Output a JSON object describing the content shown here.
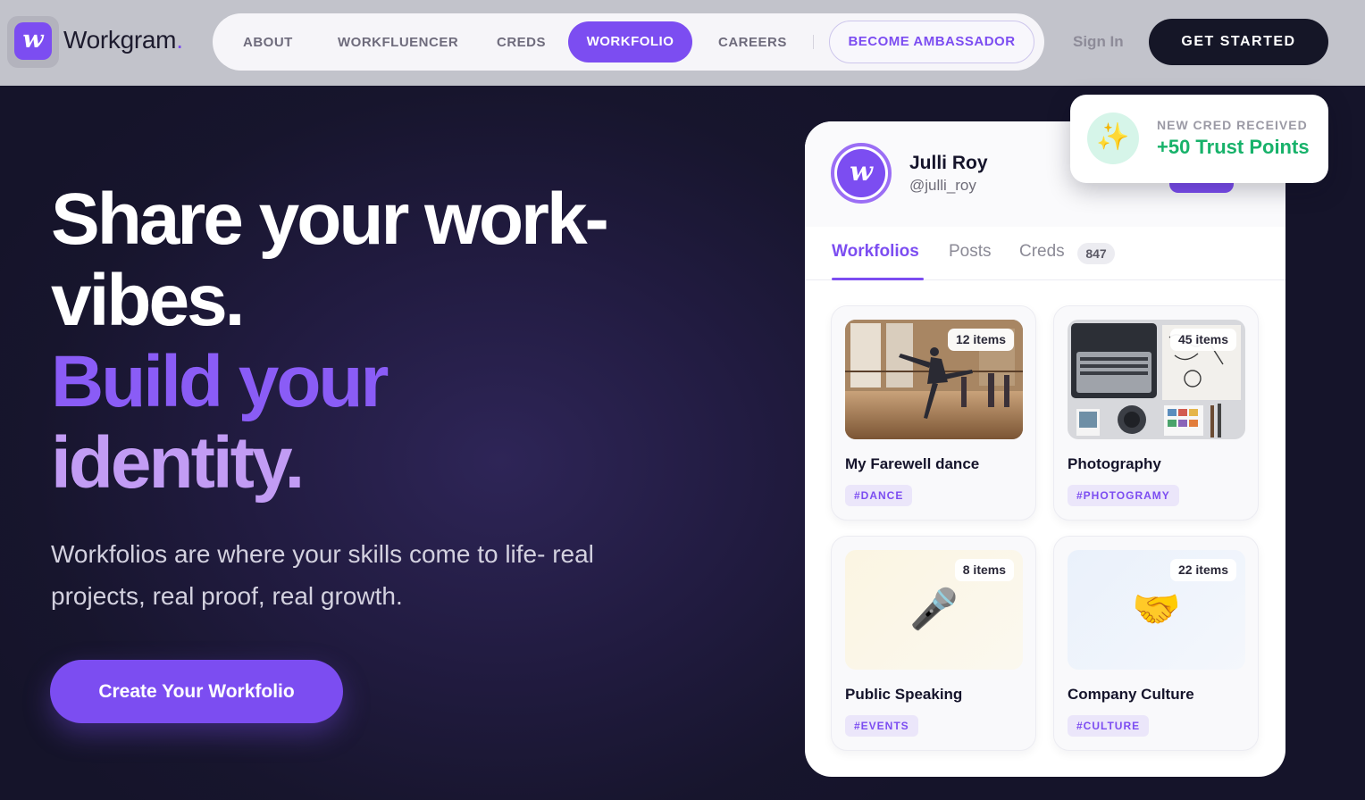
{
  "brand": {
    "name": "Workgram",
    "dot": ".",
    "mark": "w",
    "accent": "#7c4df1"
  },
  "nav": {
    "items": [
      "ABOUT",
      "WORKFLUENCER",
      "CREDS",
      "WORKFOLIO",
      "CAREERS"
    ],
    "active": "WORKFOLIO",
    "ambassador": "BECOME AMBASSADOR",
    "signin": "Sign In",
    "cta": "GET STARTED"
  },
  "hero": {
    "line1": "Share your work-",
    "line2": "vibes.",
    "line3": "Build your",
    "line4": "identity.",
    "subtitle": "Workfolios are where your skills come to life- real projects, real proof, real growth.",
    "cta": "Create Your Workfolio"
  },
  "profile": {
    "name": "Julli Roy",
    "handle": "@julli_roy",
    "avatar_letter": "w",
    "tabs": [
      "Workfolios",
      "Posts",
      "Creds"
    ],
    "active_tab": "Workfolios",
    "creds_count": "847",
    "workfolios": [
      {
        "title": "My Farewell dance",
        "tag": "#DANCE",
        "count": "12 items",
        "image": "dance-photo"
      },
      {
        "title": "Photography",
        "tag": "#PHOTOGRAMY",
        "count": "45 items",
        "image": "desk-photo"
      },
      {
        "title": "Public Speaking",
        "tag": "#EVENTS",
        "count": "8 items",
        "icon": "microphone-icon",
        "glyph": "🎤"
      },
      {
        "title": "Company Culture",
        "tag": "#CULTURE",
        "count": "22 items",
        "icon": "handshake-icon",
        "glyph": "🤝"
      }
    ]
  },
  "toast": {
    "label": "NEW CRED RECEIVED",
    "value": "+50 Trust Points",
    "icon": "sparkles-icon",
    "glyph": "✨",
    "value_color": "#17b26a"
  }
}
